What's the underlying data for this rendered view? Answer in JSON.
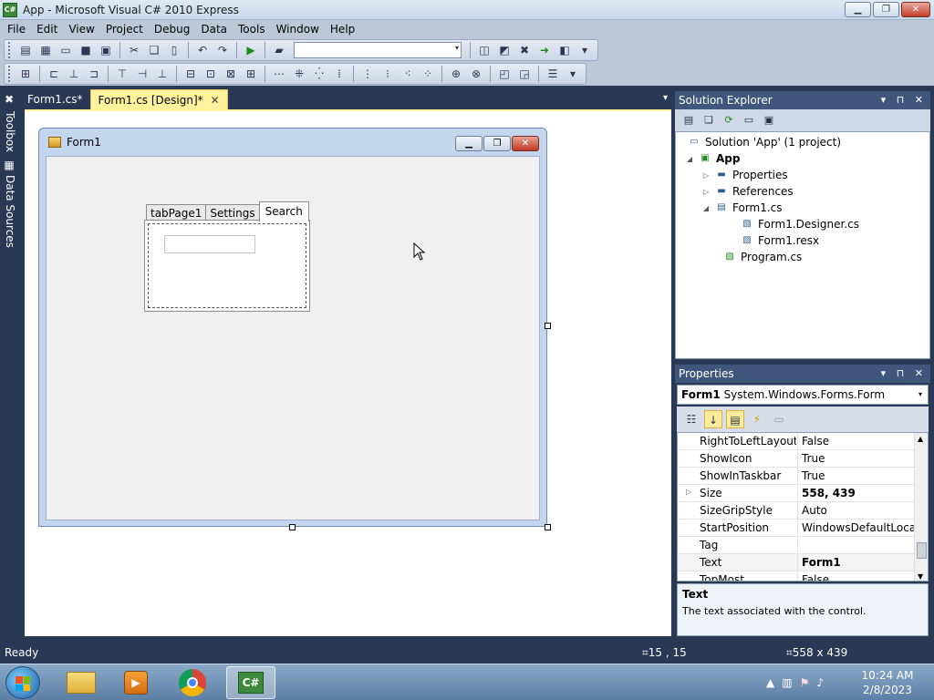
{
  "window": {
    "title": "App - Microsoft Visual C# 2010 Express",
    "icon_label": "C#",
    "minimize_glyph": "▁",
    "restore_glyph": "❐",
    "close_glyph": "✕"
  },
  "menu": [
    "File",
    "Edit",
    "View",
    "Project",
    "Debug",
    "Data",
    "Tools",
    "Window",
    "Help"
  ],
  "toolbar": {
    "config_value": "",
    "combo_arrow": "▾",
    "grip_arrow": "▾"
  },
  "left_rail": {
    "toolbox": "Toolbox",
    "data_sources": "Data Sources"
  },
  "doc_tabs": [
    {
      "label": "Form1.cs*",
      "active": false
    },
    {
      "label": "Form1.cs [Design]*",
      "active": true
    }
  ],
  "doc_tab_close": "✕",
  "doc_tabs_dropdown": "▾",
  "form": {
    "caption": "Form1",
    "tabs": [
      "tabPage1",
      "Settings",
      "Search"
    ],
    "selected_tab": "Search",
    "search_value": ""
  },
  "solution_explorer": {
    "title": "Solution Explorer",
    "pin_glyphs": "▾ ⊓ ✕",
    "tree": [
      {
        "label": "Solution 'App' (1 project)",
        "indent": 0,
        "toggle": "",
        "icon": "solution-icon",
        "bold": false
      },
      {
        "label": "App",
        "indent": 1,
        "toggle": "◢",
        "icon": "csharp-project-icon",
        "bold": true
      },
      {
        "label": "Properties",
        "indent": 2,
        "toggle": "▷",
        "icon": "properties-folder-icon",
        "bold": false
      },
      {
        "label": "References",
        "indent": 2,
        "toggle": "▷",
        "icon": "references-folder-icon",
        "bold": false
      },
      {
        "label": "Form1.cs",
        "indent": 2,
        "toggle": "◢",
        "icon": "form-file-icon",
        "bold": false
      },
      {
        "label": "Form1.Designer.cs",
        "indent": 3,
        "toggle": "",
        "icon": "cs-file-icon",
        "bold": false
      },
      {
        "label": "Form1.resx",
        "indent": 3,
        "toggle": "",
        "icon": "resx-file-icon",
        "bold": false
      },
      {
        "label": "Program.cs",
        "indent": 2,
        "toggle": "",
        "icon": "cs-file-icon",
        "bold": false
      }
    ]
  },
  "properties": {
    "title": "Properties",
    "pin_glyphs": "▾ ⊓ ✕",
    "object_name": "Form1",
    "object_type": "System.Windows.Forms.Form",
    "rows": [
      {
        "name": "RightToLeftLayout",
        "value": "False",
        "bold": false,
        "expandable": false,
        "selected": false
      },
      {
        "name": "ShowIcon",
        "value": "True",
        "bold": false,
        "expandable": false,
        "selected": false
      },
      {
        "name": "ShowInTaskbar",
        "value": "True",
        "bold": false,
        "expandable": false,
        "selected": false
      },
      {
        "name": "Size",
        "value": "558, 439",
        "bold": true,
        "expandable": true,
        "selected": false
      },
      {
        "name": "SizeGripStyle",
        "value": "Auto",
        "bold": false,
        "expandable": false,
        "selected": false
      },
      {
        "name": "StartPosition",
        "value": "WindowsDefaultLocation",
        "bold": false,
        "expandable": false,
        "selected": false
      },
      {
        "name": "Tag",
        "value": "",
        "bold": false,
        "expandable": false,
        "selected": false
      },
      {
        "name": "Text",
        "value": "Form1",
        "bold": true,
        "expandable": false,
        "selected": true
      },
      {
        "name": "TopMost",
        "value": "False",
        "bold": false,
        "expandable": false,
        "selected": false
      }
    ],
    "description_title": "Text",
    "description_text": "The text associated with the control."
  },
  "status": {
    "text": "Ready",
    "position": "15 , 15",
    "size": "558 x 439"
  },
  "taskbar": {
    "time": "10:24 AM",
    "date": "2/8/2023"
  },
  "colors": {
    "ide_dark": "#293955",
    "active_tab": "#fff29d",
    "form_border": "#c3d6ee"
  }
}
